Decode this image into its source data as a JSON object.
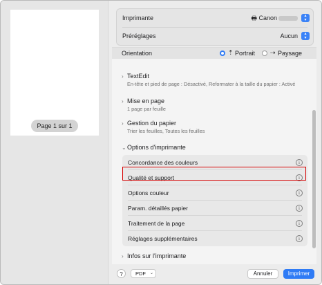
{
  "preview": {
    "page_label": "Page 1 sur 1"
  },
  "printer": {
    "printer_label": "Imprimante",
    "printer_value": "Canon",
    "presets_label": "Préréglages",
    "presets_value": "Aucun"
  },
  "orientation": {
    "label": "Orientation",
    "portrait": "Portrait",
    "landscape": "Paysage",
    "selected": "Portrait"
  },
  "sections": [
    {
      "title": "TextEdit",
      "subtitle": "En-tête et pied de page : Désactivé, Reformater à la taille du papier : Activé"
    },
    {
      "title": "Mise en page",
      "subtitle": "1 page par feuille"
    },
    {
      "title": "Gestion du papier",
      "subtitle": "Trier les feuilles, Toutes les feuilles"
    }
  ],
  "printer_options": {
    "title": "Options d'imprimante",
    "items": [
      "Concordance des couleurs",
      "Qualité et support",
      "Options couleur",
      "Param. détaillés papier",
      "Traitement de la page",
      "Réglages supplémentaires"
    ],
    "highlighted": "Qualité et support"
  },
  "printer_info": {
    "title": "Infos sur l'imprimante"
  },
  "footer": {
    "help": "?",
    "pdf": "PDF",
    "cancel": "Annuler",
    "print": "Imprimer"
  },
  "colors": {
    "accent": "#2f7bf5",
    "highlight": "#d60000"
  }
}
